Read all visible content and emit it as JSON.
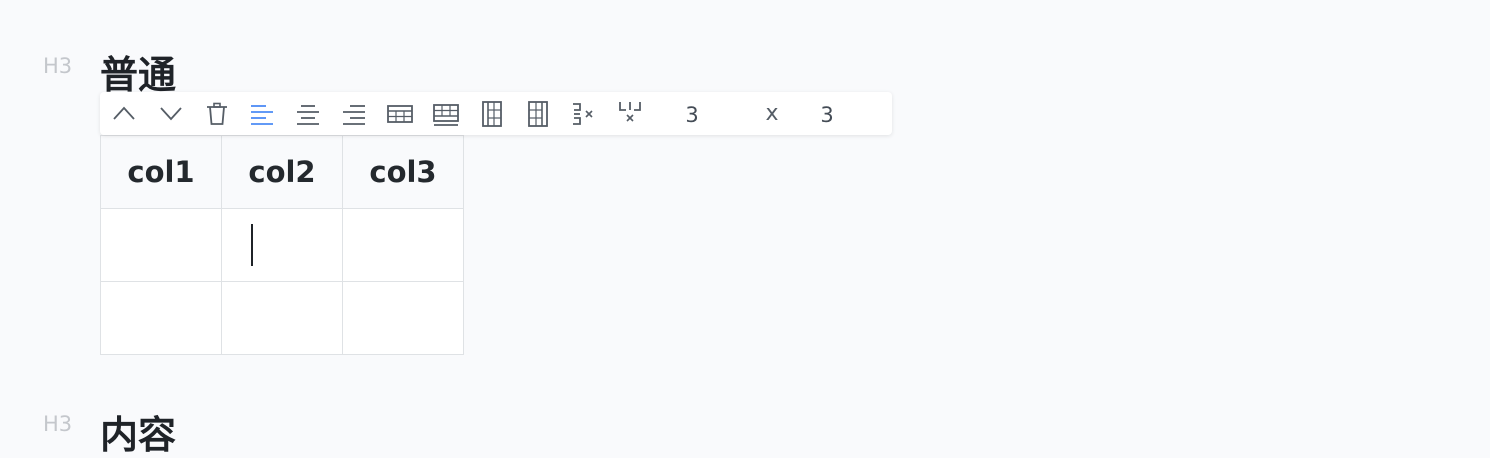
{
  "blocks": [
    {
      "marker": "H3",
      "text": "普通"
    },
    {
      "marker": "H3",
      "text": "内容"
    }
  ],
  "toolbar": {
    "buttons": [
      {
        "name": "move-up-icon",
        "active": false
      },
      {
        "name": "move-down-icon",
        "active": false
      },
      {
        "name": "trash-icon",
        "active": false
      },
      {
        "name": "align-left-icon",
        "active": true
      },
      {
        "name": "align-center-icon",
        "active": false
      },
      {
        "name": "align-right-icon",
        "active": false
      },
      {
        "name": "insert-row-above-icon",
        "active": false
      },
      {
        "name": "insert-row-below-icon",
        "active": false
      },
      {
        "name": "insert-column-left-icon",
        "active": false
      },
      {
        "name": "insert-column-right-icon",
        "active": false
      },
      {
        "name": "delete-row-icon",
        "active": false
      },
      {
        "name": "delete-column-icon",
        "active": false
      }
    ],
    "rows": "3",
    "separator": "x",
    "cols": "3"
  },
  "table": {
    "headers": [
      "col1",
      "col2",
      "col3"
    ],
    "rows": [
      [
        "",
        "",
        ""
      ],
      [
        "",
        "",
        ""
      ]
    ]
  },
  "colors": {
    "accent": "#4c8bf5",
    "icon": "#555d66"
  }
}
